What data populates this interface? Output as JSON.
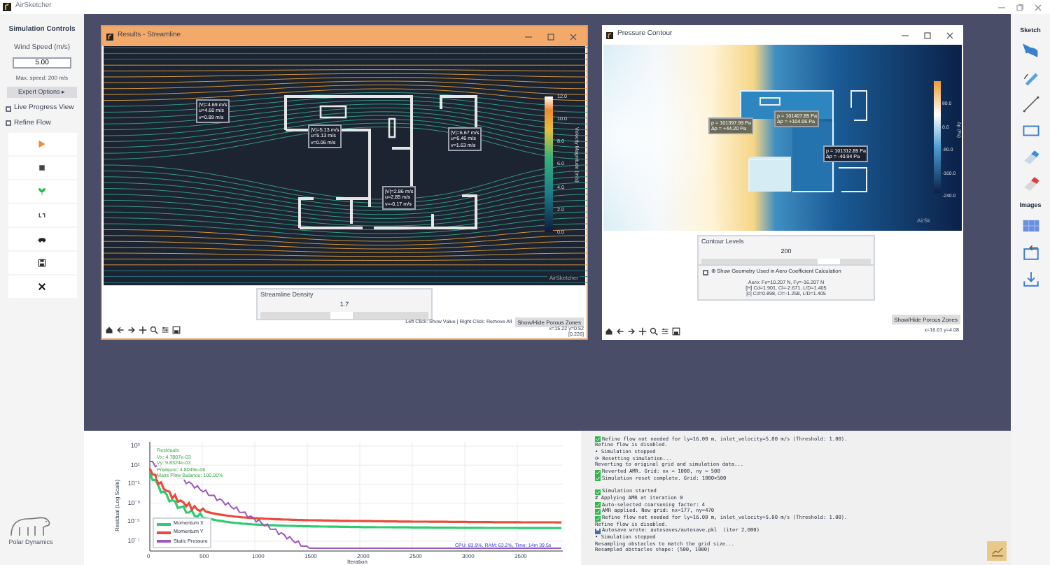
{
  "app": {
    "title": "AirSketcher"
  },
  "sidebar": {
    "heading": "Simulation Controls",
    "wind_speed": {
      "label": "Wind Speed (m/s)",
      "value": "5.00"
    },
    "max_speed": "Max. speed: 200 m/s",
    "expert_button": "Expert Options ▸",
    "checkboxes": [
      {
        "label": "Live Progress View",
        "checked": false
      },
      {
        "label": "Refine Flow",
        "checked": false
      }
    ],
    "buttons": [
      {
        "kind": "play"
      },
      {
        "kind": "stop"
      },
      {
        "kind": "seed"
      },
      {
        "kind": "reset"
      },
      {
        "kind": "car"
      },
      {
        "kind": "save"
      },
      {
        "kind": "close"
      }
    ]
  },
  "logo": {
    "text": "Polar Dynamics"
  },
  "streamline_window": {
    "title": "Results - Streamline",
    "probes": [
      {
        "lines": [
          "|V|=4.69 m/s",
          "u=4.60 m/s",
          "v=0.89 m/s"
        ]
      },
      {
        "lines": [
          "|V|=5.13 m/s",
          "u=5.13 m/s",
          "v=0.06 m/s"
        ]
      },
      {
        "lines": [
          "|V|=6.67 m/s",
          "u=6.46 m/s",
          "v=1.63 m/s"
        ]
      },
      {
        "lines": [
          "|V|=2.86 m/s",
          "u=2.85 m/s",
          "v=-0.17 m/s"
        ]
      }
    ],
    "colorbar": {
      "label": "Velocity Magnitude (m/s)",
      "ticks": [
        "12.0",
        "10.0",
        "8.0",
        "6.0",
        "4.0",
        "2.0",
        "0.0"
      ]
    },
    "plot_mark": "AirSketcher",
    "slider": {
      "label": "Streamline Density",
      "value": "1.7",
      "level": 0.48
    },
    "hint": "Left Click: Show Value | Right Click: Remove All",
    "porous_button": "Show/Hide Porous Zones",
    "coords": [
      "x=15.22 y=0.52",
      "[0.226]"
    ]
  },
  "pressure_window": {
    "title": "Pressure Contour",
    "probes": [
      {
        "lines": [
          "p = 101397.99 Pa",
          "Δp = +44.20 Pa"
        ]
      },
      {
        "lines": [
          "p = 101407.85 Pa",
          "Δp = +104.06 Pa"
        ]
      },
      {
        "lines": [
          "p = 101312.85 Pa",
          "Δp = -40.94 Pa"
        ]
      }
    ],
    "colorbar": {
      "label": "Δp (Pa)",
      "ticks": [
        "80.0",
        "0.0",
        "-80.0",
        "-160.0",
        "-240.0"
      ]
    },
    "plot_mark": "AirSk",
    "slider": {
      "label": "Contour Levels",
      "value": "200",
      "level": 0.75
    },
    "geometry_checkbox": {
      "label": "⊕ Show Geometry Used in Aero Coefficient Calculation",
      "checked": false
    },
    "aero_lines": [
      "Aero: Fx=10.207 N, Fy=-16.207 N",
      "[H] Cd=1.901, Cl=-2.671, L/D=1.405",
      "[c] Cd=0.898, Cl=-1.258, L/D=1.405"
    ],
    "porous_button": "Show/Hide Porous Zones",
    "coords": "x=16.01 y=4.08"
  },
  "residual_plot": {
    "ylabel": "Residual (Log Scale)",
    "xlabel": "Iteration",
    "yticks": [
      "10³",
      "10¹",
      "10⁻¹",
      "10⁻³",
      "10⁻⁵",
      "10⁻⁷"
    ],
    "xticks": [
      "0",
      "500",
      "1000",
      "1500",
      "2000",
      "2500",
      "3000",
      "3500"
    ],
    "annotations": [
      "Residuals",
      "Vx: 4.7807e-03",
      "Vy: 9.8324e-03",
      "Pressure: 4.8049e-06",
      "Mass Flow Balance: 100.00%"
    ],
    "legend": [
      {
        "label": "Momentum X",
        "color": "#2ecc71"
      },
      {
        "label": "Momentum Y",
        "color": "#e74c3c"
      },
      {
        "label": "Static Pressure",
        "color": "#9b59b6"
      }
    ],
    "status": "CPU: 83.9%, RAM: 63.2%, Time: 14m 39.5s"
  },
  "log": {
    "blocks": [
      {
        "lines": [
          {
            "kind": "ok",
            "text": "Refine flow not needed for ly=16.00 m, inlet_velocity=5.00 m/s (Threshold: 1.00)."
          },
          {
            "kind": "plain",
            "text": "Refine flow is disabled."
          },
          {
            "kind": "plain",
            "text": "• Simulation stopped"
          },
          {
            "kind": "plain",
            "text": "⟳ Resetting simulation..."
          },
          {
            "kind": "plain",
            "text": "Reverting to original grid and simulation data..."
          },
          {
            "kind": "ok",
            "text": "Reverted AMR. Grid: nx = 1000, ny = 500"
          },
          {
            "kind": "ok",
            "text": "Simulation reset complete. Grid: 1000×500"
          }
        ]
      },
      {
        "lines": [
          {
            "kind": "ok",
            "text": "Simulation started"
          },
          {
            "kind": "plain",
            "text": "# Applying AMR at iteration 0"
          },
          {
            "kind": "ok",
            "text": "Auto-selected coarsening factor: 4"
          },
          {
            "kind": "ok",
            "text": "AMR applied. New grid: nx=177, ny=470"
          },
          {
            "kind": "ok",
            "text": "Refine flow not needed for ly=16.00 m, inlet_velocity=5.00 m/s (Threshold: 1.00)."
          },
          {
            "kind": "plain",
            "text": "Refine flow is disabled."
          },
          {
            "kind": "save",
            "text": "Autosave wrote: autosaves/autosave.pkl  (iter 2,000)"
          },
          {
            "kind": "plain",
            "text": "• Simulation stopped"
          },
          {
            "kind": "plain",
            "text": "Resampling obstacles to match the grid size..."
          },
          {
            "kind": "plain",
            "text": "Resampled obstacles shape: (500, 1000)"
          }
        ]
      }
    ]
  },
  "toolbar": {
    "sections": [
      {
        "title": "Sketch",
        "tools": [
          {
            "kind": "undo"
          },
          {
            "kind": "pen"
          },
          {
            "kind": "line"
          },
          {
            "kind": "rectangle"
          },
          {
            "kind": "eraser"
          },
          {
            "kind": "fill-eraser"
          }
        ]
      },
      {
        "title": "Images",
        "tools": [
          {
            "kind": "image"
          },
          {
            "kind": "import"
          },
          {
            "kind": "download"
          }
        ]
      }
    ]
  }
}
